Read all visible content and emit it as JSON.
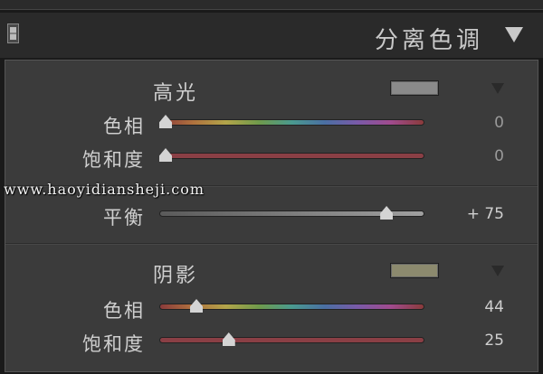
{
  "panel": {
    "title": "分离色调"
  },
  "watermark": "www.haoyidiansheji.com",
  "highlights": {
    "label": "高光",
    "swatch_color": "#8a8a8a",
    "hue": {
      "label": "色相",
      "value": "0",
      "level": 0.0
    },
    "saturation": {
      "label": "饱和度",
      "value": "0",
      "level": 0.0
    }
  },
  "balance": {
    "label": "平衡",
    "value": "+ 75",
    "level": 0.875
  },
  "shadows": {
    "label": "阴影",
    "swatch_color": "#8c8a6e",
    "hue": {
      "label": "色相",
      "value": "44",
      "level": 0.122
    },
    "saturation": {
      "label": "饱和度",
      "value": "25",
      "level": 0.25
    }
  }
}
